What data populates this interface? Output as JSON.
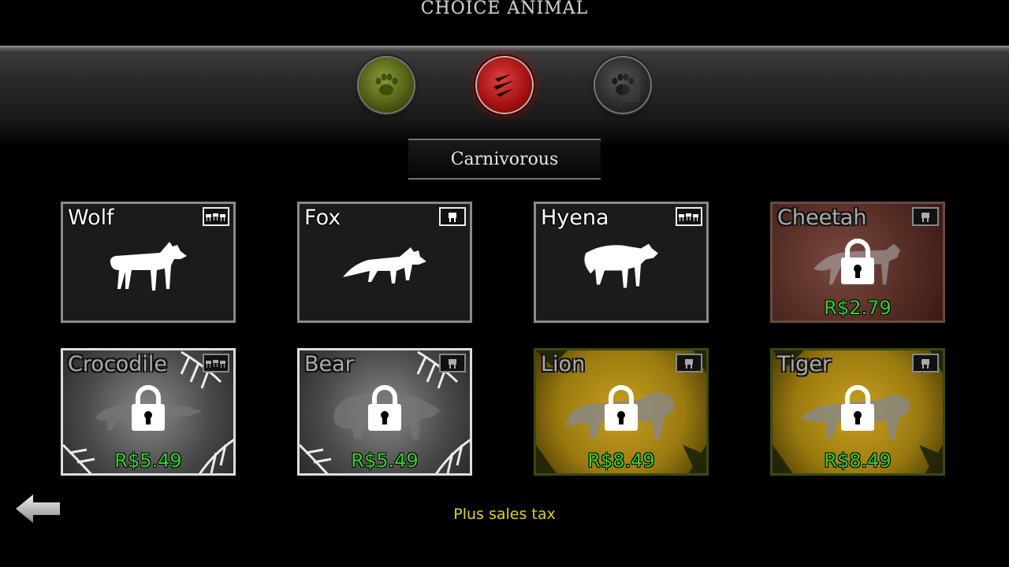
{
  "header": {
    "title": "CHOICE ANIMAL"
  },
  "categories": [
    {
      "name": "herbivore",
      "icon": "paw-icon",
      "color": "#5a6a1a"
    },
    {
      "name": "carnivore",
      "icon": "claw-scratch-icon",
      "color": "#b01818",
      "selected": true
    },
    {
      "name": "omnivore",
      "icon": "half-paw-icon",
      "color": "#333333"
    }
  ],
  "subtitle": "Carnivorous",
  "animals": [
    {
      "name": "Wolf",
      "locked": false,
      "price": "",
      "group_icon": "pack-icon"
    },
    {
      "name": "Fox",
      "locked": false,
      "price": "",
      "group_icon": "solo-icon"
    },
    {
      "name": "Hyena",
      "locked": false,
      "price": "",
      "group_icon": "pack-icon"
    },
    {
      "name": "Cheetah",
      "locked": true,
      "price": "R$2.79",
      "group_icon": "solo-icon"
    },
    {
      "name": "Crocodile",
      "locked": true,
      "price": "R$5.49",
      "group_icon": "pack-icon"
    },
    {
      "name": "Bear",
      "locked": true,
      "price": "R$5.49",
      "group_icon": "solo-icon"
    },
    {
      "name": "Lion",
      "locked": true,
      "price": "R$8.49",
      "group_icon": "solo-icon"
    },
    {
      "name": "Tiger",
      "locked": true,
      "price": "R$8.49",
      "group_icon": "solo-icon"
    }
  ],
  "footer": {
    "tax_note": "Plus sales tax",
    "back_icon": "back-arrow-icon"
  },
  "colors": {
    "price": "#35d02a",
    "tax_note": "#e0d020"
  }
}
